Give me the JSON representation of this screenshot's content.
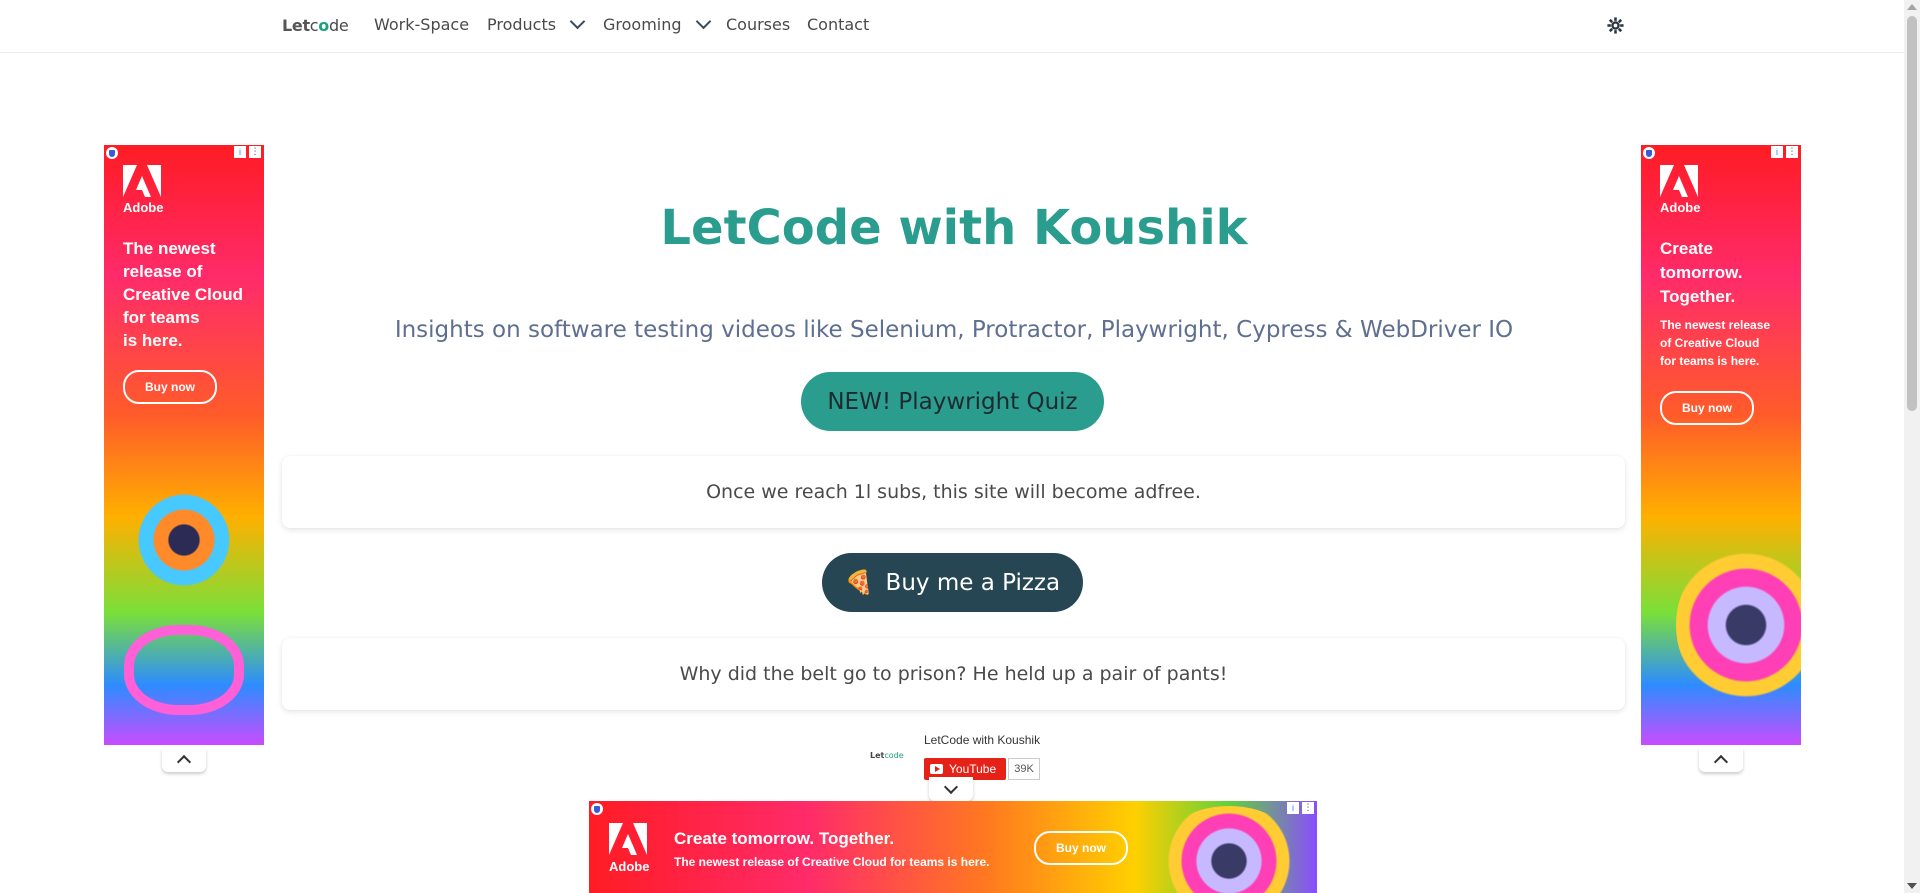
{
  "navbar": {
    "brand_part1": "Let",
    "brand_part2": "c",
    "brand_part3": "o",
    "brand_part4": "de",
    "items": [
      {
        "label": "Work-Space"
      },
      {
        "label": "Products"
      },
      {
        "label": "Grooming"
      },
      {
        "label": "Courses"
      },
      {
        "label": "Contact"
      }
    ],
    "theme_icon": "gear-icon"
  },
  "hero": {
    "title": "LetCode with Koushik",
    "subtitle": "Insights on software testing videos like Selenium, Protractor, Playwright, Cypress & WebDriver IO",
    "quiz_button": "NEW! Playwright Quiz",
    "notice": "Once we reach 1l subs, this site will become adfree.",
    "pizza_emoji": "🍕",
    "pizza_button": "Buy me a Pizza",
    "joke": "Why did the belt go to prison? He held up a pair of pants!"
  },
  "youtube": {
    "logo_part1": "Let",
    "logo_part2": "code",
    "channel_name": "LetCode with Koushik",
    "button_label": "YouTube",
    "subscriber_count": "39K"
  },
  "ads": {
    "left": {
      "brand": "Adobe",
      "headline_lines": [
        "The newest",
        "release of",
        "Creative Cloud",
        "for teams",
        "is here."
      ],
      "cta": "Buy now"
    },
    "right": {
      "brand": "Adobe",
      "headline_lines": [
        "Create",
        "tomorrow.",
        "Together."
      ],
      "sub_lines": [
        "The newest release",
        "of Creative Cloud",
        "for teams is here."
      ],
      "cta": "Buy now"
    },
    "bottom": {
      "brand": "Adobe",
      "headline": "Create tomorrow. Together.",
      "sub": "The newest release of Creative Cloud for teams is here.",
      "cta": "Buy now"
    },
    "info_glyph": "i",
    "menu_glyph": "⋮"
  },
  "colors": {
    "accent": "#2a9d8f",
    "dark": "#264653",
    "subtitle": "#5f6f8f",
    "youtube_red": "#e62117"
  }
}
